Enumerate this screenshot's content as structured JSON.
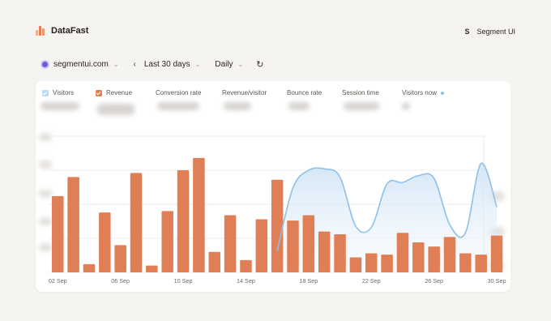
{
  "app": {
    "name": "DataFast"
  },
  "user": {
    "initial": "S",
    "name": "Segment UI"
  },
  "filters": {
    "site": "segmentui.com",
    "period": "Last 30 days",
    "granularity": "Daily"
  },
  "icons": {
    "logo": "bar-logo-icon",
    "site": "globe-icon",
    "dropdown": "chevron-down-icon",
    "prev": "chevron-left-icon",
    "refresh": "refresh-icon",
    "live": "live-dot-icon"
  },
  "colors": {
    "visitors": "#8ec1ea",
    "revenue": "#e07e55"
  },
  "metrics": {
    "visitors": "Visitors",
    "revenue": "Revenue",
    "conversion": "Conversion rate",
    "revenue_per_visitor": "Revenue/visitor",
    "bounce": "Bounce rate",
    "session": "Session time",
    "visitors_now": "Visitors now"
  },
  "chart_data": {
    "type": "bar",
    "x_tick_labels": [
      "02 Sep",
      "06 Sep",
      "10 Sep",
      "14 Sep",
      "18 Sep",
      "22 Sep",
      "26 Sep",
      "30 Sep"
    ],
    "series": [
      {
        "name": "Revenue",
        "type": "bar",
        "values": [
          56,
          70,
          6,
          44,
          20,
          73,
          5,
          45,
          75,
          84,
          15,
          42,
          9,
          39,
          68,
          38,
          42,
          30,
          28,
          11,
          14,
          13,
          29,
          22,
          19,
          26,
          14,
          13,
          27
        ]
      },
      {
        "name": "Visitors",
        "type": "area",
        "values": [
          null,
          null,
          null,
          null,
          null,
          null,
          null,
          null,
          null,
          null,
          null,
          null,
          null,
          null,
          16,
          62,
          75,
          76,
          70,
          34,
          33,
          65,
          66,
          71,
          69,
          35,
          29,
          80,
          48
        ]
      }
    ]
  }
}
